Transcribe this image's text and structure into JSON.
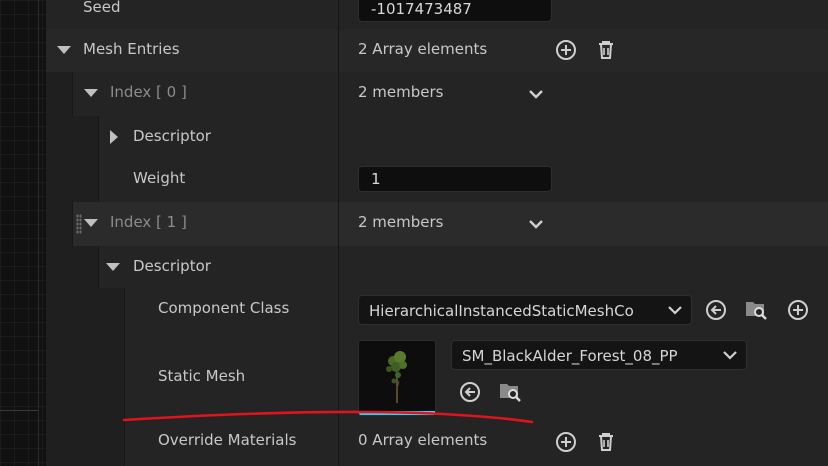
{
  "rows": {
    "seed": {
      "label": "Seed",
      "value": "-1017473487"
    },
    "mesh_entries": {
      "label": "Mesh Entries",
      "value": "2 Array elements"
    },
    "index0": {
      "label": "Index [ 0 ]",
      "value": "2 members"
    },
    "descriptor0": {
      "label": "Descriptor"
    },
    "weight": {
      "label": "Weight",
      "value": "1"
    },
    "index1": {
      "label": "Index [ 1 ]",
      "value": "2 members"
    },
    "descriptor1": {
      "label": "Descriptor"
    },
    "component_class": {
      "label": "Component Class",
      "value": "HierarchicalInstancedStaticMeshCo"
    },
    "static_mesh": {
      "label": "Static Mesh",
      "value": "SM_BlackAlder_Forest_08_PP"
    },
    "override_materials": {
      "label": "Override Materials",
      "value": "0 Array elements"
    }
  },
  "icons": {
    "add": "add-circle-icon",
    "delete": "trash-icon",
    "use_selected": "arrow-left-circle-icon",
    "browse": "folder-search-icon",
    "expand_down": "chevron-down-icon"
  },
  "colors": {
    "panel_bg": "#242424",
    "field_bg": "#0e0e0e",
    "annotation_red": "#e0141e",
    "thumbnail_accent": "#28d7ff"
  }
}
